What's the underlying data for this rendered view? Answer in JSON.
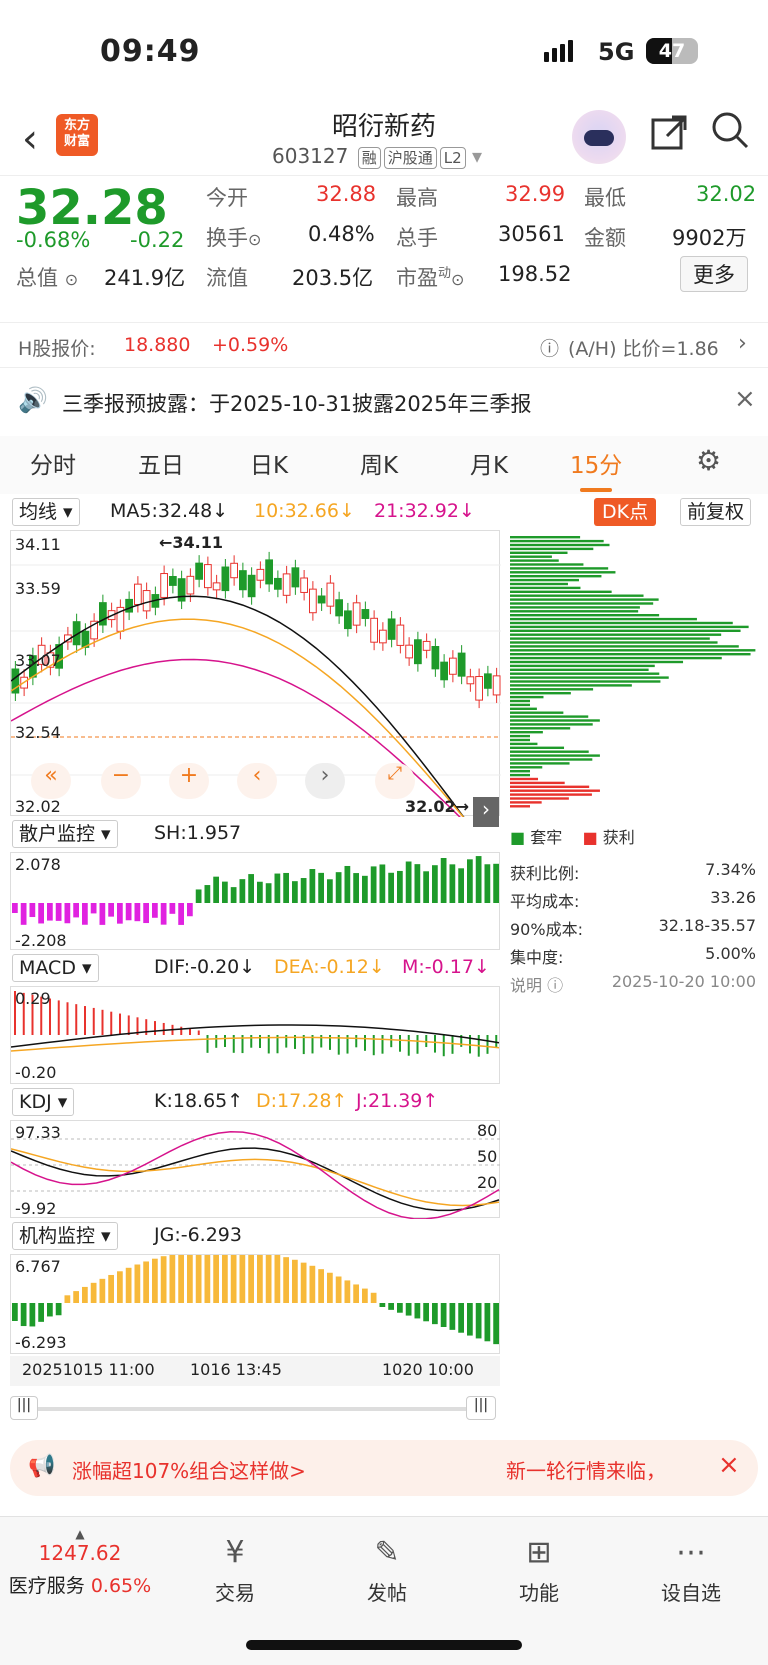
{
  "status": {
    "time": "09:49",
    "network": "5G",
    "battery": "47"
  },
  "header": {
    "logo_text": "东方\n财富",
    "stock_name": "昭衍新药",
    "stock_code": "603127",
    "tags": [
      "融",
      "沪股通",
      "L2"
    ]
  },
  "quote": {
    "price": "32.28",
    "change_pct": "-0.68%",
    "change": "-0.22",
    "open_label": "今开",
    "open": "32.88",
    "high_label": "最高",
    "high": "32.99",
    "low_label": "最低",
    "low": "32.02",
    "turnover_label": "换手",
    "turnover": "0.48%",
    "volume_label": "总手",
    "volume": "30561",
    "amount_label": "金额",
    "amount": "9902万",
    "mktcap_label": "总值",
    "mktcap": "241.9亿",
    "float_label": "流值",
    "float": "203.5亿",
    "pe_label": "市盈",
    "pe_sup": "动",
    "pe": "198.52",
    "more": "更多"
  },
  "hshare": {
    "label": "H股报价:",
    "price": "18.880",
    "pct": "+0.59%",
    "ratio": "(A/H) 比价=1.86"
  },
  "notice": {
    "text": "三季报预披露：于2025-10-31披露2025年三季报"
  },
  "tabs": [
    "分时",
    "五日",
    "日K",
    "周K",
    "月K",
    "15分"
  ],
  "main_chart": {
    "indicator_select": "均线",
    "ma5": "MA5:32.48↓",
    "ma10": "10:32.66↓",
    "ma21": "21:32.92↓",
    "dk": "DK点",
    "fq": "前复权",
    "y_labels": [
      "34.11",
      "33.59",
      "33.07",
      "32.54",
      "32.02"
    ],
    "high_mark": "←34.11",
    "low_mark": "32.02→",
    "legend_trap": "套牢",
    "legend_profit": "获利",
    "profit_ratio_label": "获利比例:",
    "profit_ratio": "7.34%",
    "avg_cost_label": "平均成本:",
    "avg_cost": "33.26",
    "cost90_label": "90%成本:",
    "cost90": "32.18-35.57",
    "conc_label": "集中度:",
    "conc": "5.00%",
    "note_label": "说明",
    "note_date": "2025-10-20 10:00"
  },
  "retail": {
    "select": "散户监控",
    "value": "SH:1.957",
    "max": "2.078",
    "min": "-2.208"
  },
  "macd": {
    "select": "MACD",
    "dif": "DIF:-0.20↓",
    "dea": "DEA:-0.12↓",
    "m": "M:-0.17↓",
    "max": "0.29",
    "min": "-0.20"
  },
  "kdj": {
    "select": "KDJ",
    "k": "K:18.65↑",
    "d": "D:17.28↑",
    "j": "J:21.39↑",
    "max": "97.33",
    "min": "-9.92",
    "levels": [
      "80",
      "50",
      "20"
    ]
  },
  "inst": {
    "select": "机构监控",
    "value": "JG:-6.293",
    "max": "6.767",
    "min": "-6.293"
  },
  "xaxis": [
    "20251015 11:00",
    "1016 13:45",
    "1020 10:00"
  ],
  "ad": {
    "left": "涨幅超107%组合这样做>",
    "right": "新一轮行情来临，"
  },
  "bottom": {
    "index_value": "1247.62",
    "index_name": "医疗服务",
    "index_pct": "0.65%",
    "nav": [
      "交易",
      "发帖",
      "功能",
      "设自选"
    ]
  },
  "colors": {
    "up": "#e8322d",
    "down": "#1e9a2a",
    "accent": "#f07a1e",
    "ma5": "#111111",
    "ma10": "#f5a623",
    "ma21": "#d6138c"
  }
}
